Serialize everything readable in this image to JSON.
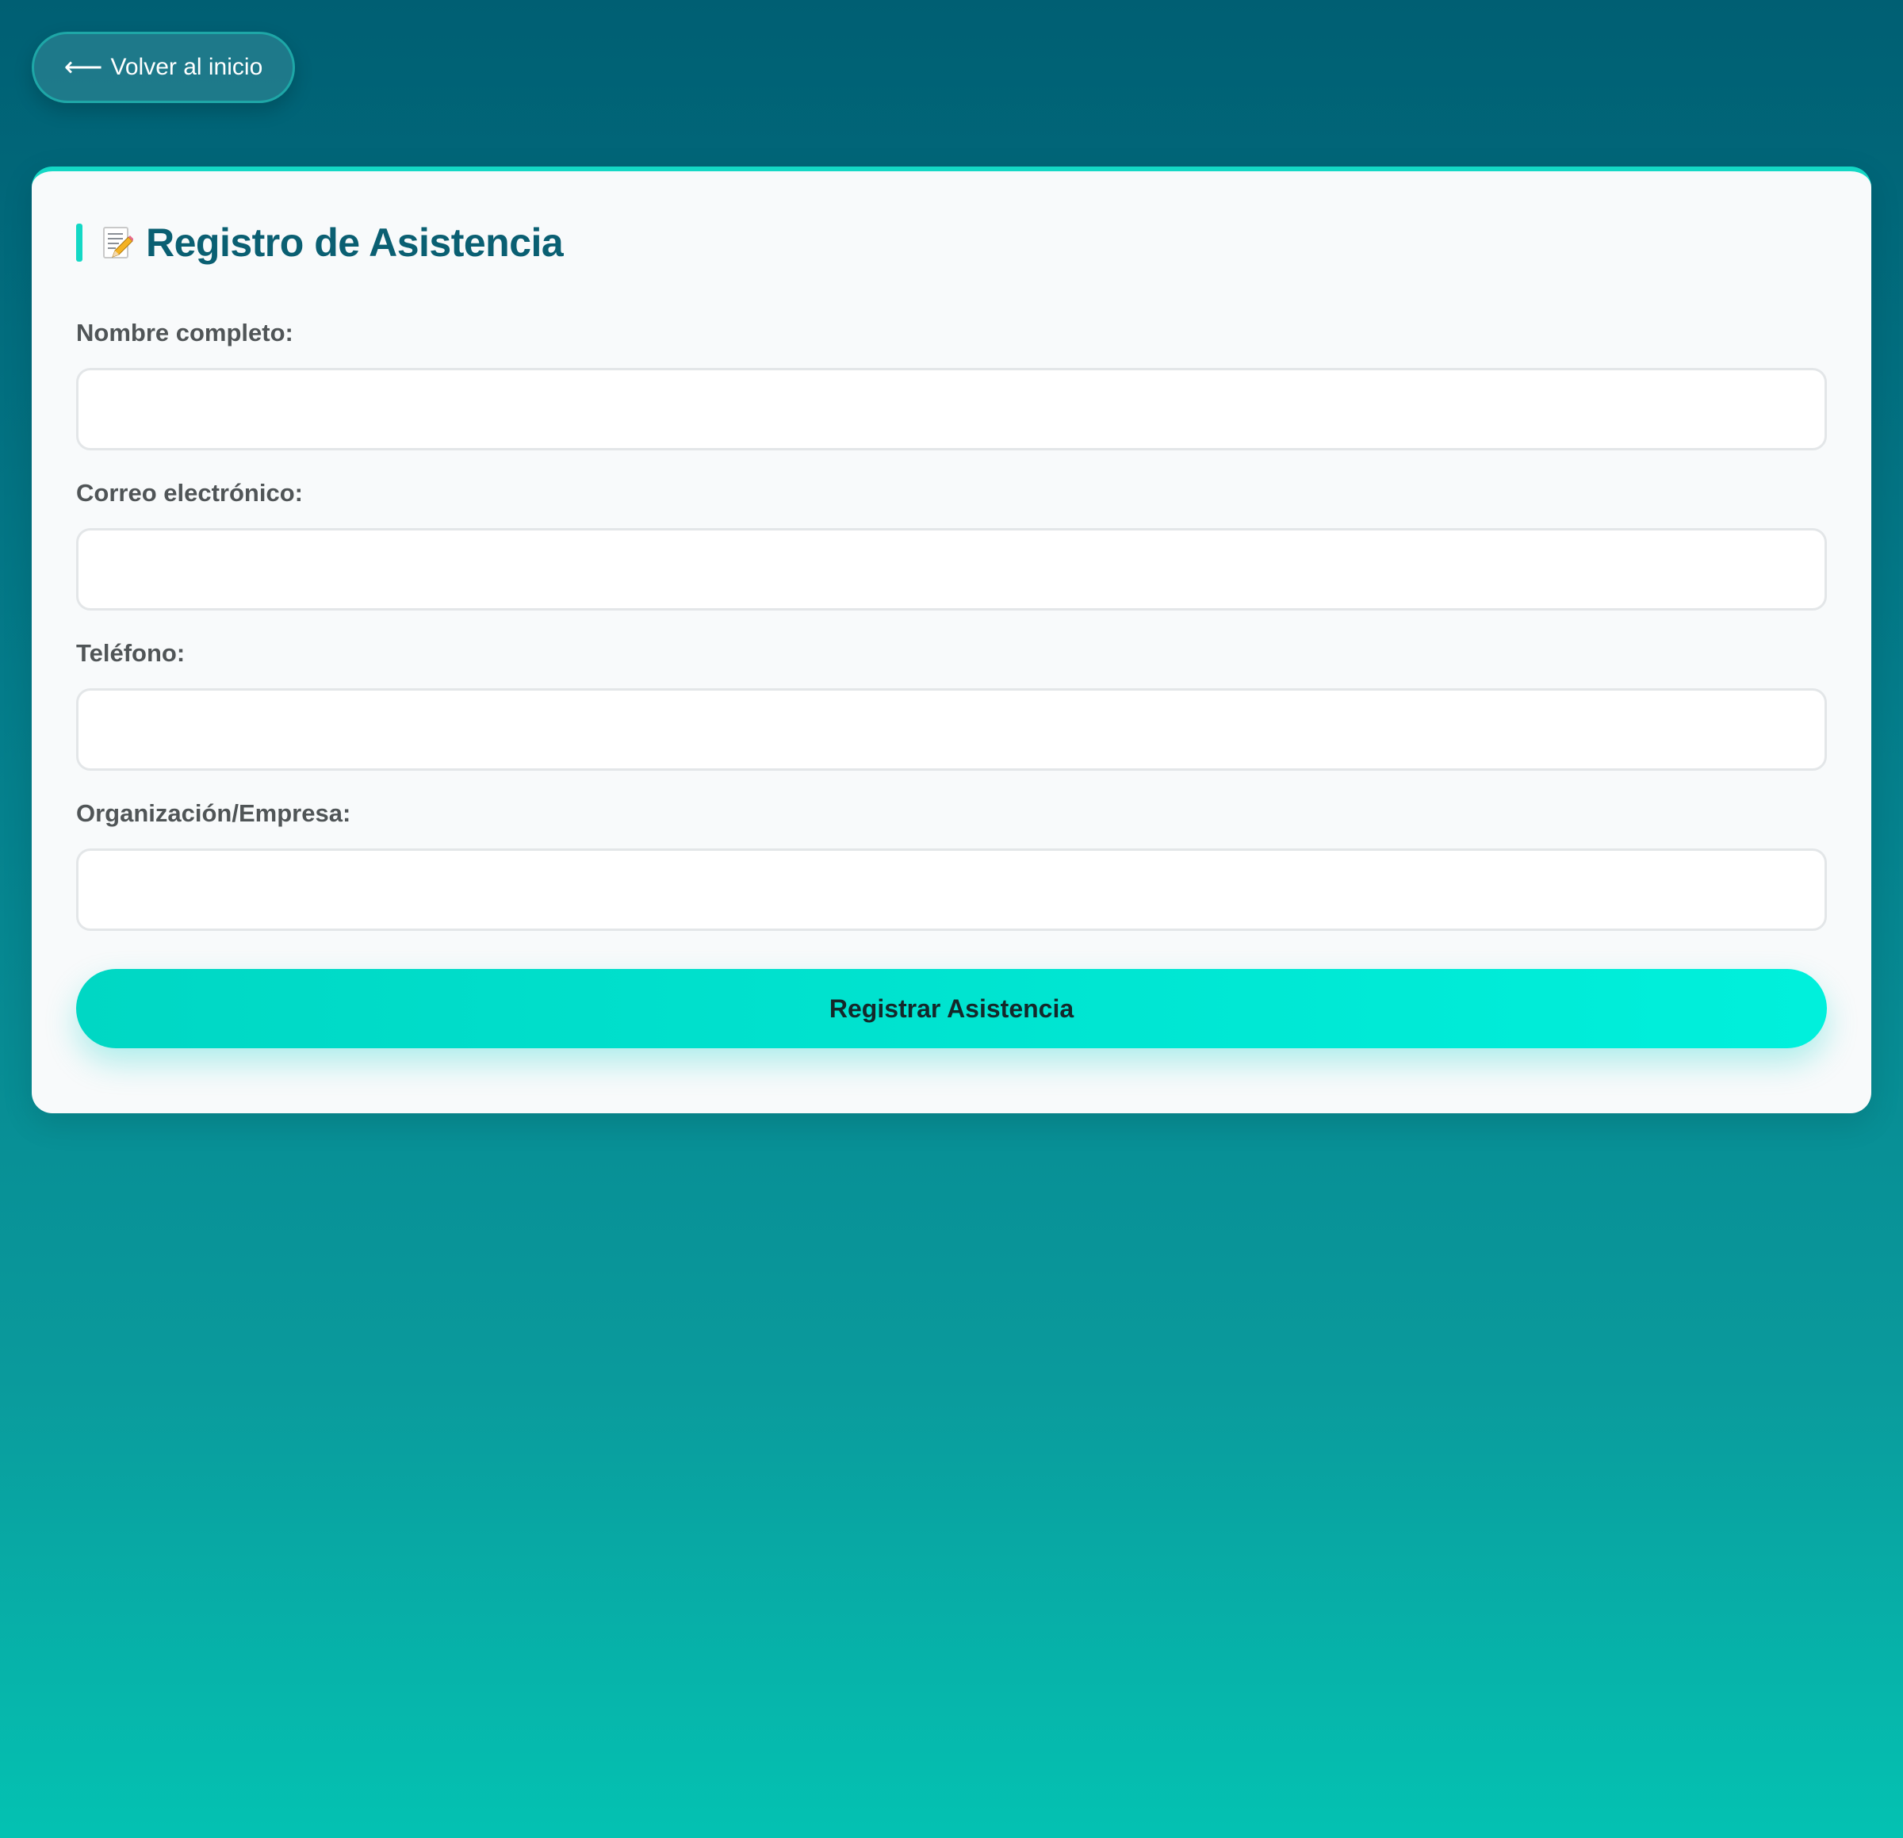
{
  "back_button": {
    "label": "Volver al inicio",
    "icon": "arrow-left-icon",
    "glyph": "⟵"
  },
  "form": {
    "title": "Registro de Asistencia",
    "title_icon": "memo-icon",
    "fields": [
      {
        "label": "Nombre completo:",
        "value": "",
        "placeholder": ""
      },
      {
        "label": "Correo electrónico:",
        "value": "",
        "placeholder": ""
      },
      {
        "label": "Teléfono:",
        "value": "",
        "placeholder": ""
      },
      {
        "label": "Organización/Empresa:",
        "value": "",
        "placeholder": ""
      }
    ],
    "submit_label": "Registrar Asistencia"
  },
  "colors": {
    "accent": "#14d8c5",
    "title": "#0a5f72",
    "background_top": "#005f73",
    "background_bottom": "#04c2b2"
  }
}
